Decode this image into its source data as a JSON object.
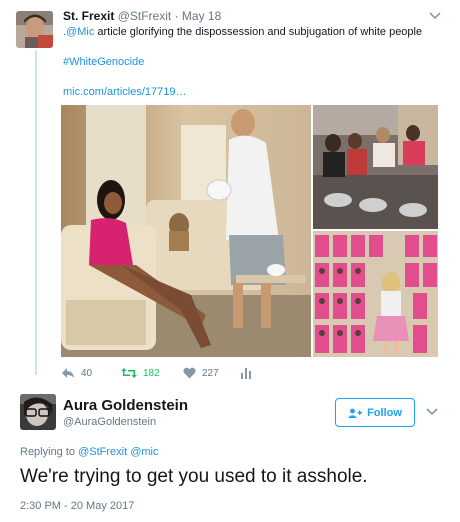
{
  "tweet1": {
    "display_name": "St. Frexit",
    "handle": "@StFrexit",
    "separator": "·",
    "date": "May 18",
    "mention": ".@Mic",
    "text": " article glorifying the dispossession and subjugation of white people",
    "hashtag": "#WhiteGenocide",
    "url": "mic.com/articles/17719…",
    "reply_count": "40",
    "retweet_count": "182",
    "like_count": "227",
    "icons": [
      "reply-icon",
      "retweet-icon",
      "heart-icon",
      "analytics-icon",
      "chevron-down-icon"
    ]
  },
  "tweet2": {
    "display_name": "Aura Goldenstein",
    "handle": "@AuraGoldenstein",
    "follow_label": "Follow",
    "replying_prefix": "Replying to ",
    "replying_handles": "@StFrexit @mic",
    "text": "We're trying to get you used to it asshole.",
    "timestamp": "2:30 PM - 20 May 2017"
  },
  "colors": {
    "link": "#1b95e0",
    "accent": "#1da1f2",
    "retweet": "#17bf63",
    "secondary_text": "#657786",
    "thread_line": "#cce3f3"
  }
}
